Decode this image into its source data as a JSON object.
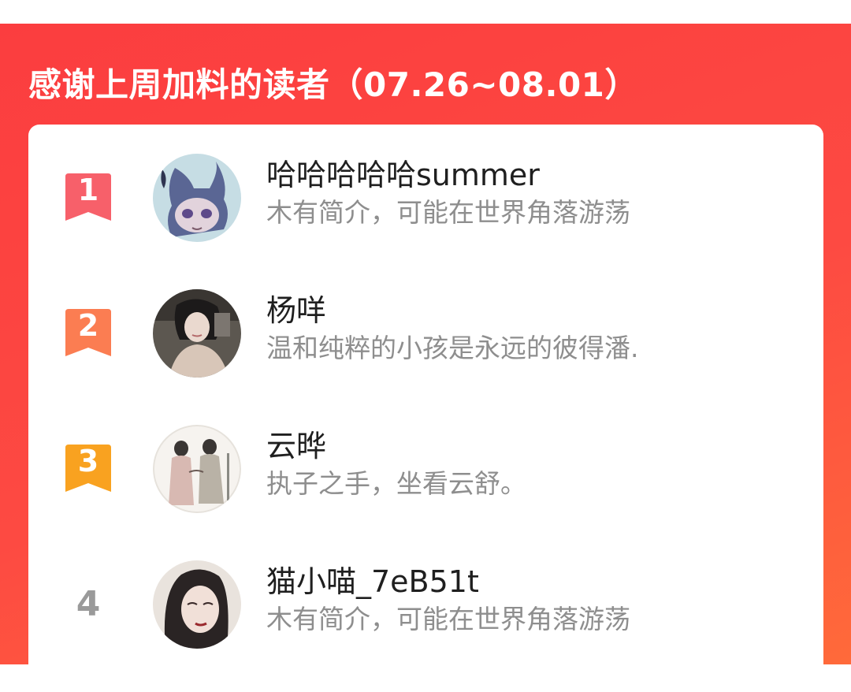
{
  "header": {
    "title": "感谢上周加料的读者（07.26~08.01）"
  },
  "colors": {
    "panel_bg": "#fb3d3f",
    "rank1": "#f7606a",
    "rank2": "#fb7d52",
    "rank3": "#f9a220",
    "rank_plain": "#9a9a9a"
  },
  "readers": [
    {
      "rank": "1",
      "name": "哈哈哈哈哈summer",
      "bio": "木有简介，可能在世界角落游荡",
      "avatar": "anime-character-avatar"
    },
    {
      "rank": "2",
      "name": "杨咩",
      "bio": "温和纯粹的小孩是永远的彼得潘.",
      "avatar": "girl-photo-avatar"
    },
    {
      "rank": "3",
      "name": "云晔",
      "bio": "执子之手，坐看云舒。",
      "avatar": "ink-painting-couple-avatar"
    },
    {
      "rank": "4",
      "name": "猫小喵_7eB51t",
      "bio": "木有简介，可能在世界角落游荡",
      "avatar": "woman-portrait-avatar"
    }
  ]
}
